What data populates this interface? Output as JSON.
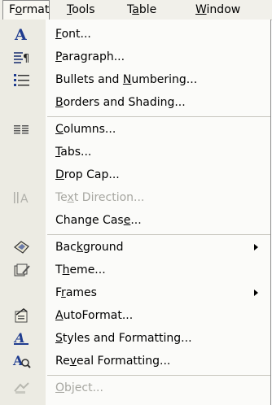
{
  "menubar": {
    "items": [
      {
        "pre": "F",
        "u": "o",
        "post": "rmat"
      },
      {
        "pre": "",
        "u": "T",
        "post": "ools"
      },
      {
        "pre": "T",
        "u": "a",
        "post": "ble"
      },
      {
        "pre": "",
        "u": "W",
        "post": "indow"
      }
    ]
  },
  "menu": {
    "items": [
      {
        "pre": "",
        "u": "F",
        "post": "ont...",
        "icon": "font-icon",
        "disabled": false,
        "submenu": false
      },
      {
        "pre": "",
        "u": "P",
        "post": "aragraph...",
        "icon": "paragraph-icon",
        "disabled": false,
        "submenu": false
      },
      {
        "pre": "Bullets and ",
        "u": "N",
        "post": "umbering...",
        "icon": "bullets-icon",
        "disabled": false,
        "submenu": false
      },
      {
        "pre": "",
        "u": "B",
        "post": "orders and Shading...",
        "icon": "",
        "disabled": false,
        "submenu": false
      },
      {
        "pre": "",
        "u": "C",
        "post": "olumns...",
        "icon": "columns-icon",
        "disabled": false,
        "submenu": false
      },
      {
        "pre": "",
        "u": "T",
        "post": "abs...",
        "icon": "",
        "disabled": false,
        "submenu": false
      },
      {
        "pre": "",
        "u": "D",
        "post": "rop Cap...",
        "icon": "",
        "disabled": false,
        "submenu": false
      },
      {
        "pre": "Te",
        "u": "x",
        "post": "t Direction...",
        "icon": "text-direction-icon",
        "disabled": true,
        "submenu": false
      },
      {
        "pre": "Change Cas",
        "u": "e",
        "post": "...",
        "icon": "",
        "disabled": false,
        "submenu": false
      },
      {
        "pre": "Bac",
        "u": "k",
        "post": "ground",
        "icon": "background-icon",
        "disabled": false,
        "submenu": true
      },
      {
        "pre": "T",
        "u": "h",
        "post": "eme...",
        "icon": "theme-icon",
        "disabled": false,
        "submenu": false
      },
      {
        "pre": "F",
        "u": "r",
        "post": "ames",
        "icon": "",
        "disabled": false,
        "submenu": true
      },
      {
        "pre": "",
        "u": "A",
        "post": "utoFormat...",
        "icon": "autoformat-icon",
        "disabled": false,
        "submenu": false
      },
      {
        "pre": "",
        "u": "S",
        "post": "tyles and Formatting...",
        "icon": "styles-formatting-icon",
        "disabled": false,
        "submenu": false
      },
      {
        "pre": "Re",
        "u": "v",
        "post": "eal Formatting...",
        "icon": "reveal-formatting-icon",
        "disabled": false,
        "submenu": false
      },
      {
        "pre": "",
        "u": "O",
        "post": "bject...",
        "icon": "object-icon",
        "disabled": true,
        "submenu": false
      }
    ]
  }
}
